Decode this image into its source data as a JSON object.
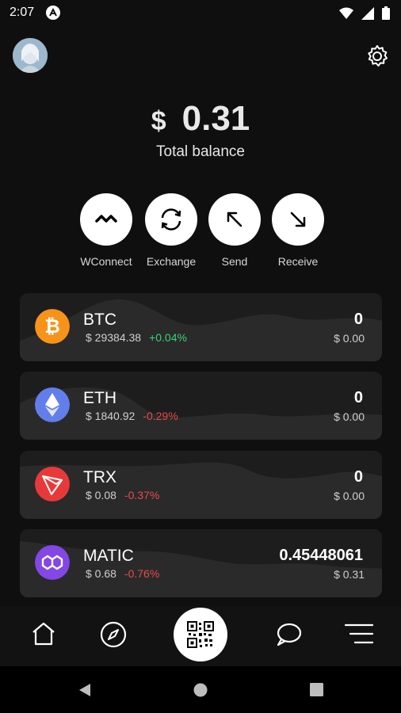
{
  "status_bar": {
    "time": "2:07"
  },
  "balance": {
    "currency": "$",
    "amount": "0.31",
    "label": "Total balance"
  },
  "actions": [
    {
      "label": "WConnect",
      "icon": "walletconnect-icon"
    },
    {
      "label": "Exchange",
      "icon": "exchange-icon"
    },
    {
      "label": "Send",
      "icon": "send-arrow-icon"
    },
    {
      "label": "Receive",
      "icon": "receive-arrow-icon"
    }
  ],
  "assets": [
    {
      "symbol": "BTC",
      "price": "$ 29384.38",
      "change": "+0.04%",
      "change_dir": "up",
      "quantity": "0",
      "usd_value": "$ 0.00",
      "color": "#f7931a",
      "icon": "bitcoin-icon"
    },
    {
      "symbol": "ETH",
      "price": "$ 1840.92",
      "change": "-0.29%",
      "change_dir": "down",
      "quantity": "0",
      "usd_value": "$ 0.00",
      "color": "#627eea",
      "icon": "ethereum-icon"
    },
    {
      "symbol": "TRX",
      "price": "$ 0.08",
      "change": "-0.37%",
      "change_dir": "down",
      "quantity": "0",
      "usd_value": "$ 0.00",
      "color": "#e8393a",
      "icon": "tron-icon"
    },
    {
      "symbol": "MATIC",
      "price": "$ 0.68",
      "change": "-0.76%",
      "change_dir": "down",
      "quantity": "0.45448061",
      "usd_value": "$ 0.31",
      "color": "#8247e5",
      "icon": "polygon-icon"
    }
  ],
  "colors": {
    "background": "#0f0f0f",
    "card": "#1d1d1d",
    "positive": "#3bd17a",
    "negative": "#e84b4b"
  },
  "bottom_nav": [
    "home-icon",
    "compass-icon",
    "qr-code-icon",
    "chat-icon",
    "menu-icon"
  ]
}
